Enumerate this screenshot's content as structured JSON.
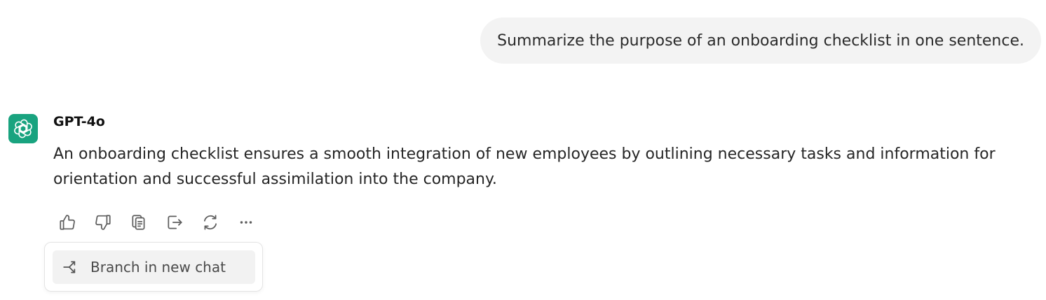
{
  "user_message": {
    "text": "Summarize the purpose of an onboarding checklist in one sentence."
  },
  "assistant": {
    "avatar_icon": "openai-logo-icon",
    "avatar_color": "#19a37f",
    "model_name": "GPT-4o",
    "reply": "An onboarding checklist ensures a smooth integration of new employees by outlining necessary tasks and information for orientation and successful assimilation into the company."
  },
  "actions": [
    {
      "icon": "thumbs-up-icon"
    },
    {
      "icon": "thumbs-down-icon"
    },
    {
      "icon": "copy-icon"
    },
    {
      "icon": "share-icon"
    },
    {
      "icon": "regenerate-icon"
    },
    {
      "icon": "more-options-icon"
    }
  ],
  "menu": {
    "branch_label": "Branch in new chat",
    "branch_icon": "branch-icon"
  }
}
